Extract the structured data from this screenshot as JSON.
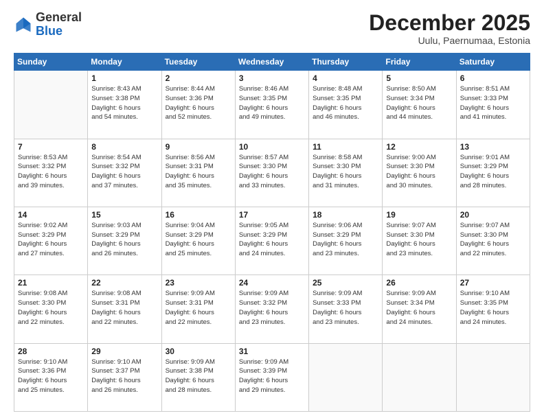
{
  "logo": {
    "general": "General",
    "blue": "Blue"
  },
  "header": {
    "month": "December 2025",
    "location": "Uulu, Paernumaa, Estonia"
  },
  "weekdays": [
    "Sunday",
    "Monday",
    "Tuesday",
    "Wednesday",
    "Thursday",
    "Friday",
    "Saturday"
  ],
  "weeks": [
    [
      {
        "day": "",
        "info": ""
      },
      {
        "day": "1",
        "info": "Sunrise: 8:43 AM\nSunset: 3:38 PM\nDaylight: 6 hours\nand 54 minutes."
      },
      {
        "day": "2",
        "info": "Sunrise: 8:44 AM\nSunset: 3:36 PM\nDaylight: 6 hours\nand 52 minutes."
      },
      {
        "day": "3",
        "info": "Sunrise: 8:46 AM\nSunset: 3:35 PM\nDaylight: 6 hours\nand 49 minutes."
      },
      {
        "day": "4",
        "info": "Sunrise: 8:48 AM\nSunset: 3:35 PM\nDaylight: 6 hours\nand 46 minutes."
      },
      {
        "day": "5",
        "info": "Sunrise: 8:50 AM\nSunset: 3:34 PM\nDaylight: 6 hours\nand 44 minutes."
      },
      {
        "day": "6",
        "info": "Sunrise: 8:51 AM\nSunset: 3:33 PM\nDaylight: 6 hours\nand 41 minutes."
      }
    ],
    [
      {
        "day": "7",
        "info": "Sunrise: 8:53 AM\nSunset: 3:32 PM\nDaylight: 6 hours\nand 39 minutes."
      },
      {
        "day": "8",
        "info": "Sunrise: 8:54 AM\nSunset: 3:32 PM\nDaylight: 6 hours\nand 37 minutes."
      },
      {
        "day": "9",
        "info": "Sunrise: 8:56 AM\nSunset: 3:31 PM\nDaylight: 6 hours\nand 35 minutes."
      },
      {
        "day": "10",
        "info": "Sunrise: 8:57 AM\nSunset: 3:30 PM\nDaylight: 6 hours\nand 33 minutes."
      },
      {
        "day": "11",
        "info": "Sunrise: 8:58 AM\nSunset: 3:30 PM\nDaylight: 6 hours\nand 31 minutes."
      },
      {
        "day": "12",
        "info": "Sunrise: 9:00 AM\nSunset: 3:30 PM\nDaylight: 6 hours\nand 30 minutes."
      },
      {
        "day": "13",
        "info": "Sunrise: 9:01 AM\nSunset: 3:29 PM\nDaylight: 6 hours\nand 28 minutes."
      }
    ],
    [
      {
        "day": "14",
        "info": "Sunrise: 9:02 AM\nSunset: 3:29 PM\nDaylight: 6 hours\nand 27 minutes."
      },
      {
        "day": "15",
        "info": "Sunrise: 9:03 AM\nSunset: 3:29 PM\nDaylight: 6 hours\nand 26 minutes."
      },
      {
        "day": "16",
        "info": "Sunrise: 9:04 AM\nSunset: 3:29 PM\nDaylight: 6 hours\nand 25 minutes."
      },
      {
        "day": "17",
        "info": "Sunrise: 9:05 AM\nSunset: 3:29 PM\nDaylight: 6 hours\nand 24 minutes."
      },
      {
        "day": "18",
        "info": "Sunrise: 9:06 AM\nSunset: 3:29 PM\nDaylight: 6 hours\nand 23 minutes."
      },
      {
        "day": "19",
        "info": "Sunrise: 9:07 AM\nSunset: 3:30 PM\nDaylight: 6 hours\nand 23 minutes."
      },
      {
        "day": "20",
        "info": "Sunrise: 9:07 AM\nSunset: 3:30 PM\nDaylight: 6 hours\nand 22 minutes."
      }
    ],
    [
      {
        "day": "21",
        "info": "Sunrise: 9:08 AM\nSunset: 3:30 PM\nDaylight: 6 hours\nand 22 minutes."
      },
      {
        "day": "22",
        "info": "Sunrise: 9:08 AM\nSunset: 3:31 PM\nDaylight: 6 hours\nand 22 minutes."
      },
      {
        "day": "23",
        "info": "Sunrise: 9:09 AM\nSunset: 3:31 PM\nDaylight: 6 hours\nand 22 minutes."
      },
      {
        "day": "24",
        "info": "Sunrise: 9:09 AM\nSunset: 3:32 PM\nDaylight: 6 hours\nand 23 minutes."
      },
      {
        "day": "25",
        "info": "Sunrise: 9:09 AM\nSunset: 3:33 PM\nDaylight: 6 hours\nand 23 minutes."
      },
      {
        "day": "26",
        "info": "Sunrise: 9:09 AM\nSunset: 3:34 PM\nDaylight: 6 hours\nand 24 minutes."
      },
      {
        "day": "27",
        "info": "Sunrise: 9:10 AM\nSunset: 3:35 PM\nDaylight: 6 hours\nand 24 minutes."
      }
    ],
    [
      {
        "day": "28",
        "info": "Sunrise: 9:10 AM\nSunset: 3:36 PM\nDaylight: 6 hours\nand 25 minutes."
      },
      {
        "day": "29",
        "info": "Sunrise: 9:10 AM\nSunset: 3:37 PM\nDaylight: 6 hours\nand 26 minutes."
      },
      {
        "day": "30",
        "info": "Sunrise: 9:09 AM\nSunset: 3:38 PM\nDaylight: 6 hours\nand 28 minutes."
      },
      {
        "day": "31",
        "info": "Sunrise: 9:09 AM\nSunset: 3:39 PM\nDaylight: 6 hours\nand 29 minutes."
      },
      {
        "day": "",
        "info": ""
      },
      {
        "day": "",
        "info": ""
      },
      {
        "day": "",
        "info": ""
      }
    ]
  ]
}
